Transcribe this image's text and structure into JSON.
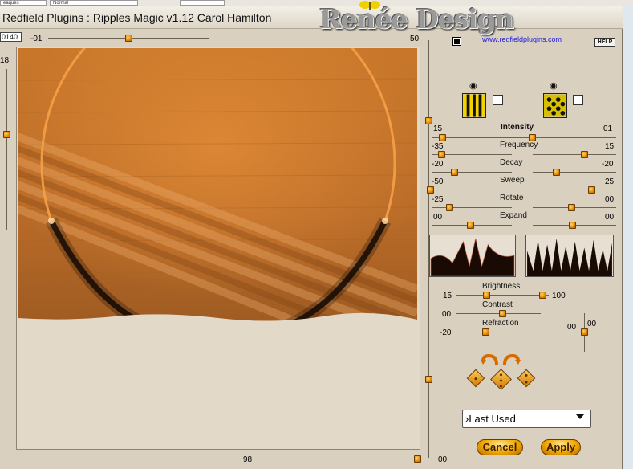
{
  "host": {
    "combo_left": "eaques",
    "combo_mid": "Normal"
  },
  "window": {
    "title": "Redfield Plugins : Ripples Magic v1.12   Carol Hamilton",
    "logo_text": "Renée Design"
  },
  "left": {
    "counter_value": "0140",
    "top_slider_value": "-01",
    "top_slider_max": "50",
    "side_slider_value": "18",
    "bottom_slider_value": "98",
    "bottom_slider_max": "00"
  },
  "right": {
    "url": "www.redfieldplugins.com",
    "help_label": "HELP",
    "params": [
      {
        "name": "Intensity",
        "left": "15",
        "right": "01"
      },
      {
        "name": "Frequency",
        "left": "-35",
        "right": "15"
      },
      {
        "name": "Decay",
        "left": "-20",
        "right": "-20"
      },
      {
        "name": "Sweep",
        "left": "-50",
        "right": "25"
      },
      {
        "name": "Rotate",
        "left": "-25",
        "right": "00"
      },
      {
        "name": "Expand",
        "left": "00",
        "right": "00"
      }
    ],
    "brightness": {
      "name": "Brightness",
      "left": "15",
      "right": "100"
    },
    "contrast": {
      "name": "Contrast",
      "left": "00"
    },
    "refraction": {
      "name": "Refraction",
      "left": "-20"
    },
    "light_values": {
      "x": "00",
      "y": "00"
    },
    "preset": "›Last Used",
    "cancel_label": "Cancel",
    "apply_label": "Apply"
  },
  "icons": [
    "eye-icon",
    "eye-icon",
    "vertical-stripes-pattern-icon",
    "checker-pattern-icon",
    "undo-arrow-icon",
    "redo-arrow-icon",
    "dice-icon"
  ],
  "colors": {
    "accent_orange": "#e88f00",
    "preview_orange": "#c97a28",
    "link_blue": "#1a1ae0"
  }
}
